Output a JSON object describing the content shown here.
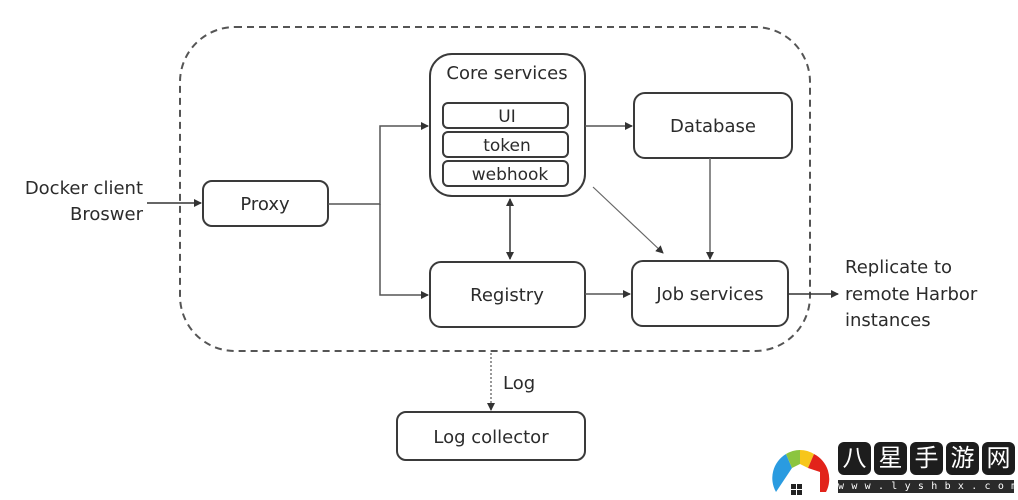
{
  "diagram": {
    "external_input": {
      "line1": "Docker client",
      "line2": "Broswer"
    },
    "nodes": {
      "proxy": "Proxy",
      "core_services": {
        "title": "Core services",
        "components": [
          "UI",
          "token",
          "webhook"
        ]
      },
      "database": "Database",
      "registry": "Registry",
      "job_services": "Job services",
      "log_collector": "Log collector"
    },
    "edge_labels": {
      "log": "Log"
    },
    "external_output": {
      "line1": "Replicate to",
      "line2": "remote Harbor",
      "line3": "instances"
    },
    "edges": [
      {
        "from": "external_input",
        "to": "proxy",
        "style": "solid"
      },
      {
        "from": "proxy",
        "to": "core_services",
        "style": "solid"
      },
      {
        "from": "proxy",
        "to": "registry",
        "style": "solid"
      },
      {
        "from": "core_services",
        "to": "registry",
        "style": "solid",
        "bidirectional": true
      },
      {
        "from": "core_services",
        "to": "database",
        "style": "solid"
      },
      {
        "from": "core_services",
        "to": "job_services",
        "style": "solid"
      },
      {
        "from": "database",
        "to": "job_services",
        "style": "solid"
      },
      {
        "from": "registry",
        "to": "job_services",
        "style": "solid"
      },
      {
        "from": "job_services",
        "to": "external_output",
        "style": "solid"
      },
      {
        "from": "harbor_boundary",
        "to": "log_collector",
        "style": "dotted",
        "label": "Log"
      }
    ]
  },
  "watermark": {
    "chars": [
      "八",
      "星",
      "手",
      "游",
      "网"
    ],
    "url": "www.lyshbx.com",
    "logo_colors": [
      "#2a9be0",
      "#8bc53f",
      "#f7c61b",
      "#e2231a"
    ]
  }
}
